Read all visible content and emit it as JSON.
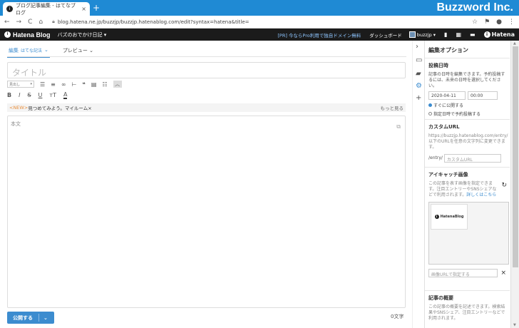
{
  "browser": {
    "tab_title": "ブログ記事編集 - はてなブログ",
    "tab_close": "×",
    "new_tab": "+",
    "url": "blog.hatena.ne.jp/buzzjp/buzzjp.hatenablog.com/edit?syntax=hatena&title=",
    "watermark": "Buzzword Inc.",
    "nav": {
      "back": "←",
      "forward": "→",
      "reload": "C",
      "home": "⌂"
    },
    "right_icons": {
      "star": "☆",
      "ext": "⚑",
      "account": "●",
      "menu": "⋮"
    }
  },
  "header": {
    "logo": "Hatena Blog",
    "blog_name": "バズのおでかけ日記",
    "blog_caret": "▾",
    "promo": "[PR] 今ならPro利用で独自ドメイン無料",
    "dashboard": "ダッシュボード",
    "user": "buzzjp",
    "user_caret": "▾",
    "icons": {
      "bookmark": "▮",
      "grid": "▦",
      "chat": "▬"
    },
    "hatena": "Hatena",
    "logo_glyph": "i"
  },
  "editor": {
    "mode_edit": "編集",
    "mode_edit_sub": "はてな記法",
    "mode_caret": "⌄",
    "mode_preview": "プレビュー",
    "title_placeholder": "タイトル",
    "heading_select": "見出し",
    "heading_caret": "▾",
    "toolbar1": {
      "ul": "☰",
      "ol": "≡",
      "link": "∞",
      "hr": "⊢",
      "quote": "❝",
      "table": "▤",
      "list": "☷",
      "collapse": "︿"
    },
    "toolbar2": {
      "bold": "B",
      "italic": "I",
      "strike": "S",
      "underline": "U",
      "size": "ᴛT",
      "color": "A"
    },
    "new_tag": "<NEW>",
    "new_text": "見つめてみよう。マイルーム×",
    "more": "もっと見る",
    "body_placeholder": "本文",
    "expand_icon": "⧉",
    "publish": "公開する",
    "publish_caret": "⌄",
    "char_count": "0文字"
  },
  "rail": {
    "chevron": "›",
    "photo": "▭",
    "folder": "▰",
    "gear": "⚙",
    "plus": "+"
  },
  "panel": {
    "title": "編集オプション",
    "date_section": "投稿日時",
    "date_help": "記事の日時を編集できます。予約投稿するには、未来の日時を選択してください。",
    "date": "2020-04-11",
    "time": "00:00",
    "radio_now": "すぐに公開する",
    "radio_schedule": "指定日時で予約投稿する",
    "url_section": "カスタムURL",
    "url_help": "https://buzzjp.hatenablog.com/entry/以下のURLを任意の文字列に変更できます。",
    "url_prefix": "/entry/",
    "url_placeholder": "カスタムURL",
    "eyecatch_section": "アイキャッチ画像",
    "eyecatch_help": "この記事を表す画像を指定できます。注目エントリーやSNSシェアなどで利用されます。",
    "eyecatch_link": "詳しくはこちら",
    "refresh": "↻",
    "thumb_label": "HatenaBlog",
    "image_url_placeholder": "画像URLで指定する",
    "image_clear": "×",
    "summary_section": "記事の概要",
    "summary_help": "この記事の概要を記述できます。検索結果やSNSシェア、注目エントリーなどで利用されます。"
  },
  "scroll": {
    "up": "▲",
    "down": "▼"
  }
}
